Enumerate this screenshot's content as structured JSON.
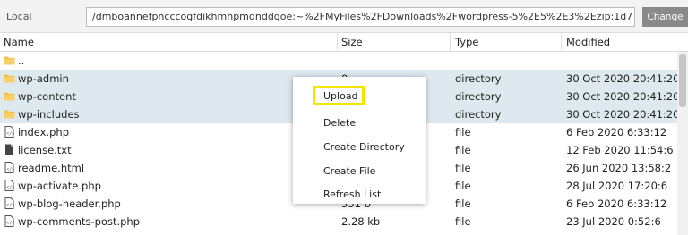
{
  "topbar": {
    "label": "Local",
    "path": "/dmboannefpncccogfdikhmhpmdnddgoe:~%2FMyFiles%2FDownloads%2Fwordpress-5%2E5%2E3%2Ezip:1d7",
    "change_label": "Change"
  },
  "columns": {
    "name": "Name",
    "size": "Size",
    "type": "Type",
    "modified": "Modified"
  },
  "rows": [
    {
      "icon": "folder-icon",
      "name": "..",
      "size": "",
      "type": "",
      "modified": ""
    },
    {
      "icon": "folder-icon",
      "name": "wp-admin",
      "size": "0",
      "type": "directory",
      "modified": "30 Oct 2020 20:41:20",
      "selected": true
    },
    {
      "icon": "folder-icon",
      "name": "wp-content",
      "size": "",
      "type": "directory",
      "modified": "30 Oct 2020 20:41:20",
      "selected": true
    },
    {
      "icon": "folder-icon",
      "name": "wp-includes",
      "size": "",
      "type": "directory",
      "modified": "30 Oct 2020 20:41:20",
      "selected": true
    },
    {
      "icon": "code-file-icon",
      "name": "index.php",
      "size": "",
      "type": "file",
      "modified": "6 Feb 2020 6:33:12"
    },
    {
      "icon": "text-file-icon",
      "name": "license.txt",
      "size": "",
      "type": "file",
      "modified": "12 Feb 2020 11:54:6"
    },
    {
      "icon": "code-file-icon",
      "name": "readme.html",
      "size": "",
      "type": "file",
      "modified": "26 Jun 2020 13:58:2"
    },
    {
      "icon": "code-file-icon",
      "name": "wp-activate.php",
      "size": "",
      "type": "file",
      "modified": "28 Jul 2020 17:20:6"
    },
    {
      "icon": "code-file-icon",
      "name": "wp-blog-header.php",
      "size": "351 b",
      "type": "file",
      "modified": "6 Feb 2020 6:33:12"
    },
    {
      "icon": "code-file-icon",
      "name": "wp-comments-post.php",
      "size": "2.28 kb",
      "type": "file",
      "modified": "23 Jul 2020 0:52:6"
    }
  ],
  "context_menu": {
    "items": [
      "Upload",
      "Delete",
      "Create Directory",
      "Create File",
      "Refresh List"
    ],
    "highlighted": "Upload",
    "highlight_color": "#f2e600"
  },
  "colors": {
    "selected_row": "#dde8ef",
    "folder": "#f5c04a",
    "change_button": "#8a8a8a"
  }
}
